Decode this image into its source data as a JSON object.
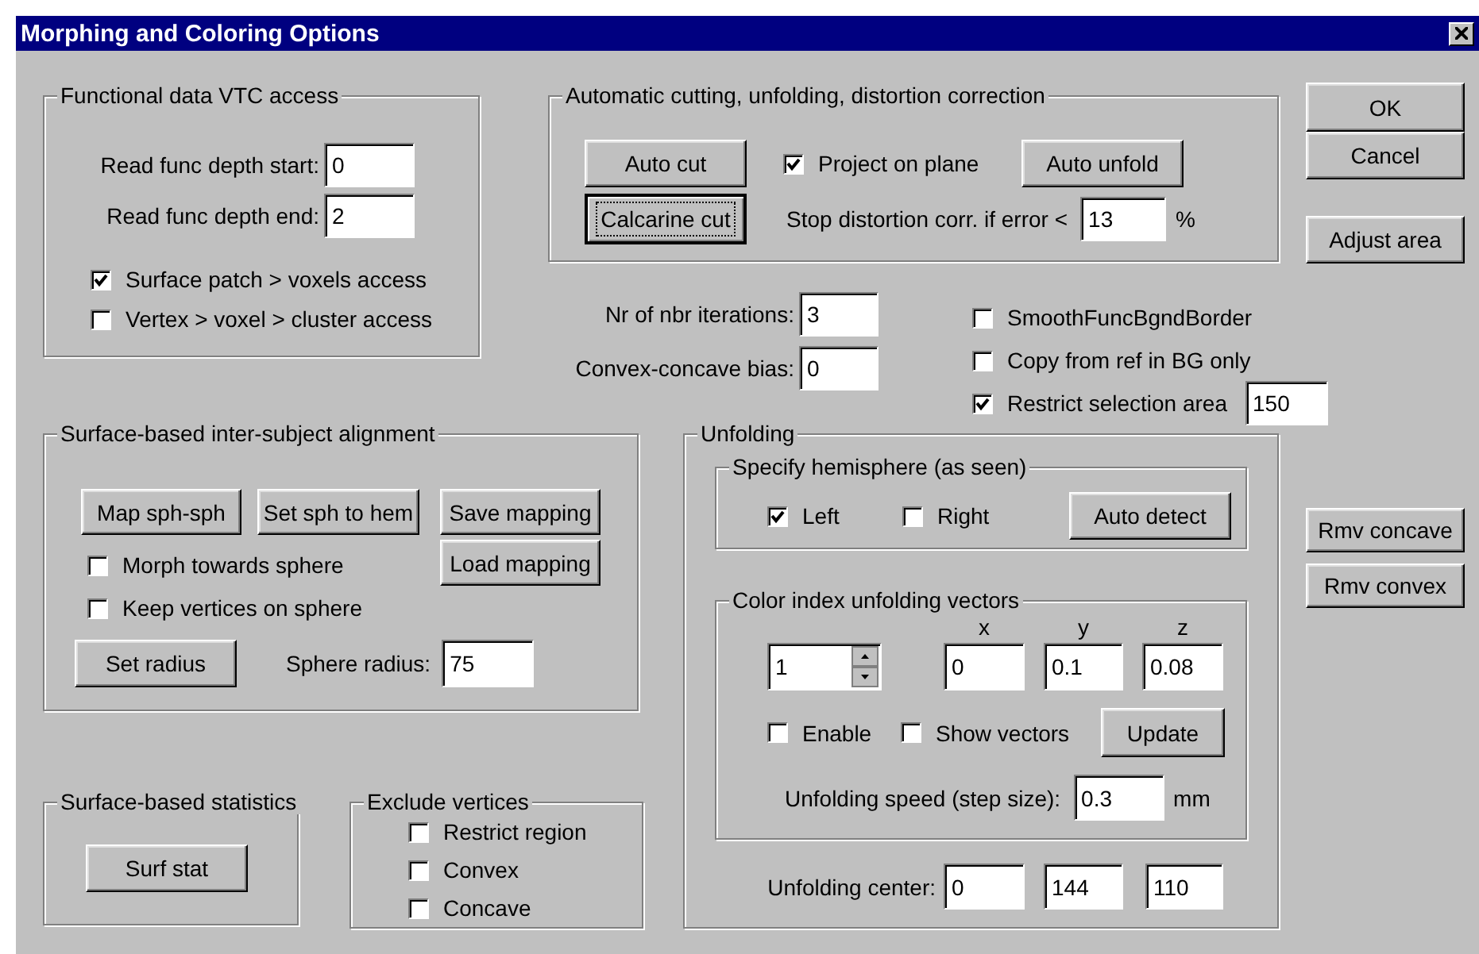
{
  "window": {
    "title": "Morphing and Coloring Options"
  },
  "dialog_buttons": [
    {
      "label": "OK"
    },
    {
      "label": "Cancel"
    },
    {
      "label": "Adjust area"
    }
  ],
  "functional_access": {
    "title": "Functional data VTC access",
    "fields": [
      {
        "label": "Read func depth start:",
        "value": "0"
      },
      {
        "label": "Read func depth end:",
        "value": "2"
      }
    ],
    "options": [
      {
        "label": "Surface patch > voxels access",
        "checked": true
      },
      {
        "label": "Vertex > voxel > cluster  access",
        "checked": false
      }
    ]
  },
  "auto_cutting": {
    "title": "Automatic cutting, unfolding, distortion correction",
    "buttons": [
      {
        "label": "Auto cut",
        "focused": false
      },
      {
        "label": "Calcarine cut",
        "focused": true
      },
      {
        "label": "Auto unfold",
        "focused": false
      }
    ],
    "project_on_plane": {
      "label": "Project on plane",
      "checked": true
    },
    "stop_distortion": {
      "label": "Stop distortion corr. if error <",
      "value": "13",
      "unit": "%"
    }
  },
  "smoothing": {
    "fields": [
      {
        "label": "Nr of nbr iterations:",
        "value": "3"
      },
      {
        "label": "Convex-concave bias:",
        "value": "0"
      }
    ],
    "options": [
      {
        "label": "SmoothFuncBgndBorder",
        "checked": false
      },
      {
        "label": "Copy from ref in BG only",
        "checked": false
      },
      {
        "label": "Restrict selection area",
        "checked": true,
        "value": "150"
      }
    ]
  },
  "alignment": {
    "title": "Surface-based inter-subject alignment",
    "buttons": [
      "Map sph-sph",
      "Set sph to hem",
      "Save mapping",
      "Load mapping"
    ],
    "options": [
      {
        "label": "Morph towards sphere",
        "checked": false
      },
      {
        "label": "Keep vertices on sphere",
        "checked": false
      }
    ],
    "set_radius": "Set radius",
    "radius": {
      "label": "Sphere radius:",
      "value": "75"
    }
  },
  "statistics": {
    "title": "Surface-based statistics",
    "button": "Surf stat"
  },
  "exclude": {
    "title": "Exclude vertices",
    "options": [
      {
        "label": "Restrict region",
        "checked": false
      },
      {
        "label": "Convex",
        "checked": false
      },
      {
        "label": "Concave",
        "checked": false
      }
    ]
  },
  "unfolding": {
    "title": "Unfolding",
    "hemisphere": {
      "title": "Specify hemisphere (as seen)",
      "options": [
        {
          "label": "Left",
          "checked": true
        },
        {
          "label": "Right",
          "checked": false
        }
      ],
      "button": "Auto detect"
    },
    "color_index": {
      "title": "Color index unfolding vectors",
      "index": "1",
      "axes": [
        {
          "label": "x",
          "value": "0"
        },
        {
          "label": "y",
          "value": "0.1"
        },
        {
          "label": "z",
          "value": "0.08"
        }
      ],
      "options": [
        {
          "label": "Enable",
          "checked": false
        },
        {
          "label": "Show vectors",
          "checked": false
        }
      ],
      "button": "Update",
      "speed": {
        "label": "Unfolding speed (step size):",
        "value": "0.3",
        "unit": "mm"
      }
    },
    "center": {
      "label": "Unfolding center:",
      "values": [
        "0",
        "144",
        "110"
      ]
    }
  },
  "side_buttons": [
    "Rmv concave",
    "Rmv convex"
  ]
}
